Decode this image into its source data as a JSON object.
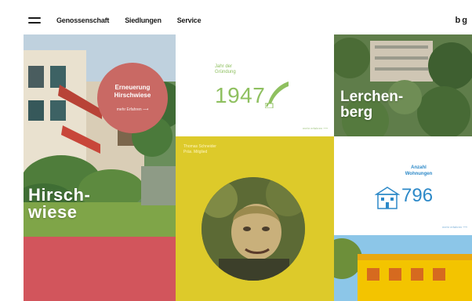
{
  "nav": {
    "items": [
      "Genossenschaft",
      "Siedlungen",
      "Service"
    ],
    "logo": "bg"
  },
  "tiles": {
    "hirschwiese": {
      "title": "Hirsch-\nwiese",
      "badge_title": "Erneuerung\nHirschwiese",
      "badge_link": "mehr Erfahren ⟶"
    },
    "year": {
      "label": "Jahr der\nGründung",
      "value": "1947",
      "more": "mehr erfahren ⟶"
    },
    "person": {
      "name": "Thomas Schneider\nPräs. Mitglied"
    },
    "lerchenberg": {
      "title": "Lerchen-\nberg"
    },
    "apartments": {
      "label": "Anzahl\nWohnungen",
      "value": "796",
      "more": "mehr erfahren ⟶"
    }
  },
  "colors": {
    "accent_red": "#d2555c",
    "accent_green": "#8fc060",
    "accent_yellow": "#ddca2a",
    "accent_blue": "#2d89c8"
  },
  "icons": {
    "menu": "hamburger-icon",
    "year": "feather-icon",
    "apartments": "building-icon"
  }
}
